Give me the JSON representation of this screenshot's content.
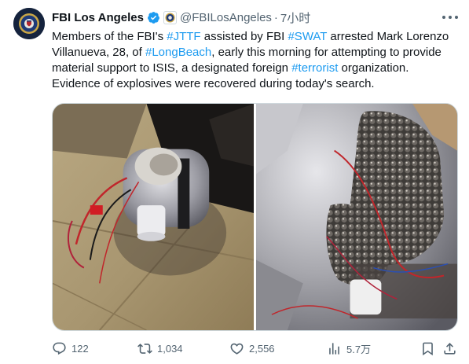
{
  "author": {
    "name": "FBI Los Angeles",
    "handle": "@FBILosAngeles",
    "separator": "·",
    "time": "7小时"
  },
  "tweet": {
    "lines": [
      [
        {
          "t": "Members of the FBI's "
        },
        {
          "t": "#JTTF",
          "tag": true
        },
        {
          "t": " assisted by FBI "
        },
        {
          "t": "#SWAT",
          "tag": true
        },
        {
          "t": " arrested Mark Lorenzo"
        }
      ],
      [
        {
          "t": "Villanueva, 28, of "
        },
        {
          "t": "#LongBeach",
          "tag": true
        },
        {
          "t": ", early this morning for attempting to provide"
        }
      ],
      [
        {
          "t": "material support to ISIS, a designated foreign "
        },
        {
          "t": "#terrorist",
          "tag": true
        },
        {
          "t": " organization."
        }
      ],
      [
        {
          "t": "Evidence of explosives were recovered during today's search."
        }
      ]
    ]
  },
  "stats": {
    "replies": "122",
    "reposts": "1,034",
    "likes": "2,556",
    "views": "5.7万"
  },
  "colors": {
    "link": "#1d9bf0",
    "verified_badge": "#1d9bf0",
    "text_primary": "#0f1419",
    "text_secondary": "#536471"
  },
  "icons": {
    "reply": "reply-icon",
    "repost": "repost-icon",
    "like": "heart-icon",
    "views": "views-icon",
    "bookmark": "bookmark-icon",
    "share": "share-icon",
    "more": "more-icon",
    "verified": "verified-badge-icon"
  }
}
